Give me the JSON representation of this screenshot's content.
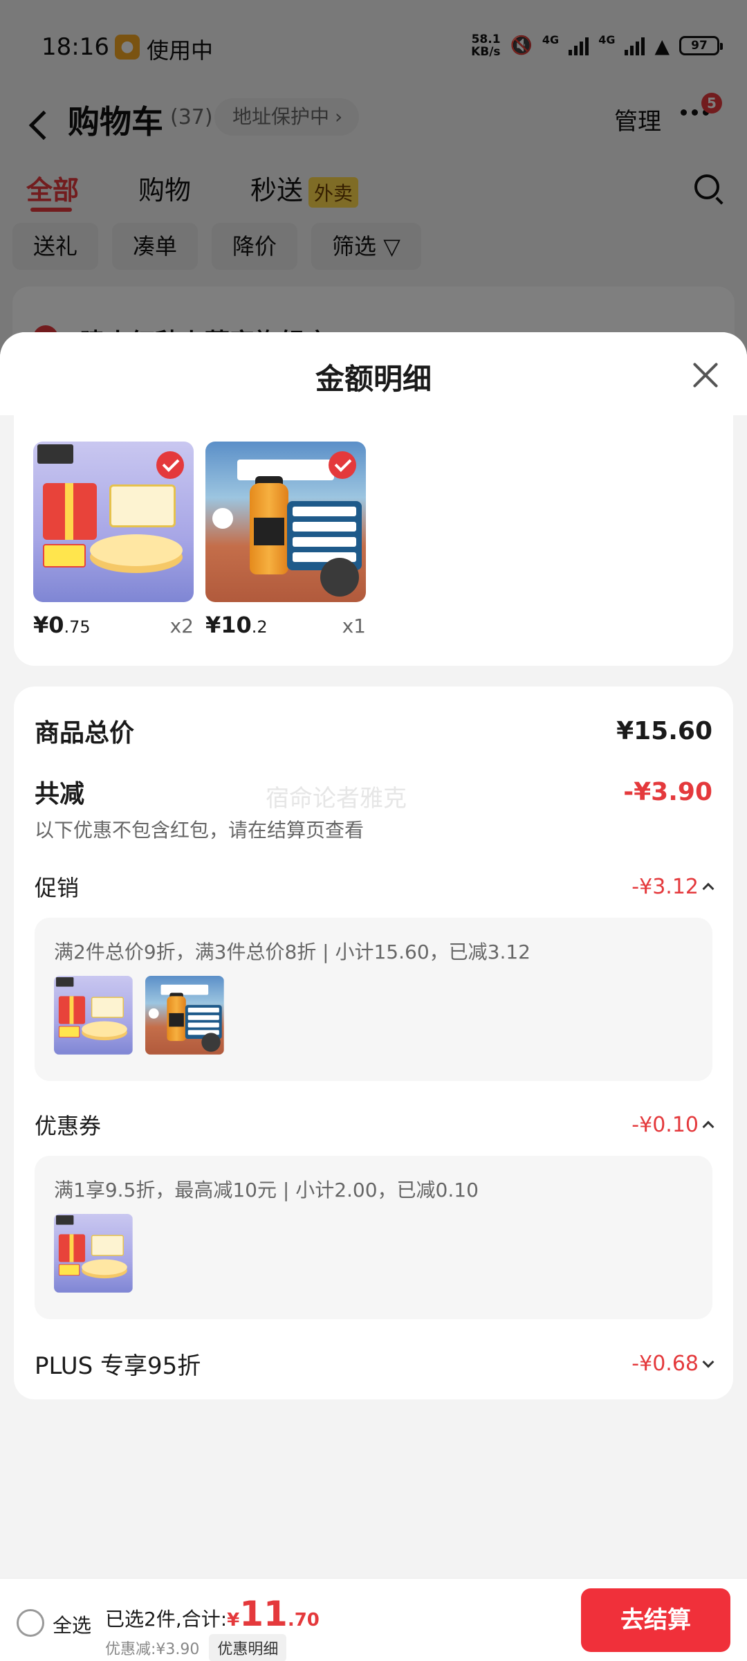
{
  "status_bar": {
    "time": "18:16",
    "app_in_use": "使用中",
    "net_speed_value": "58.1",
    "net_speed_unit": "KB/s",
    "signal_1": "4G",
    "signal_2": "4G",
    "battery": "97"
  },
  "background": {
    "title": "购物车",
    "count": "(37)",
    "address_pill": "地址保护中",
    "manage": "管理",
    "more_badge": "5",
    "tabs": [
      {
        "label": "全部"
      },
      {
        "label": "购物"
      },
      {
        "label": "秒送"
      }
    ],
    "waimai_tag": "外卖",
    "chips": [
      {
        "label": "送礼"
      },
      {
        "label": "凑单"
      },
      {
        "label": "降价"
      },
      {
        "label": "筛选"
      }
    ],
    "store_name": "建小红秋上蒙家旗舰店"
  },
  "sheet": {
    "title": "金额明细",
    "items": [
      {
        "price_int": "¥0",
        "price_dec": ".75",
        "qty": "x2"
      },
      {
        "price_int": "¥10",
        "price_dec": ".2",
        "qty": "x1"
      }
    ],
    "total_label": "商品总价",
    "total_value": "¥15.60",
    "reduce_label": "共减",
    "reduce_value": "-¥3.90",
    "reduce_note": "以下优惠不包含红包，请在结算页查看",
    "watermark": "宿命论者雅克",
    "promo": {
      "label": "促销",
      "value": "-¥3.12",
      "detail": "满2件总价9折，满3件总价8折 | 小计15.60，已减3.12"
    },
    "coupon": {
      "label": "优惠券",
      "value": "-¥0.10",
      "detail": "满1享9.5折，最高减10元 | 小计2.00，已减0.10"
    },
    "plus": {
      "label": "PLUS 专享95折",
      "value": "-¥0.68"
    }
  },
  "bottom_bar": {
    "select_all": "全选",
    "selected_text": "已选2件,合计:",
    "total_currency": "¥",
    "total_int": "11",
    "total_dec": ".70",
    "discount_text": "优惠减:¥3.90",
    "detail_pill": "优惠明细",
    "checkout": "去结算"
  },
  "colors": {
    "accent_red": "#e4393c",
    "checkout_red": "#f0303a",
    "waimai_yellow": "#ffd84d"
  }
}
